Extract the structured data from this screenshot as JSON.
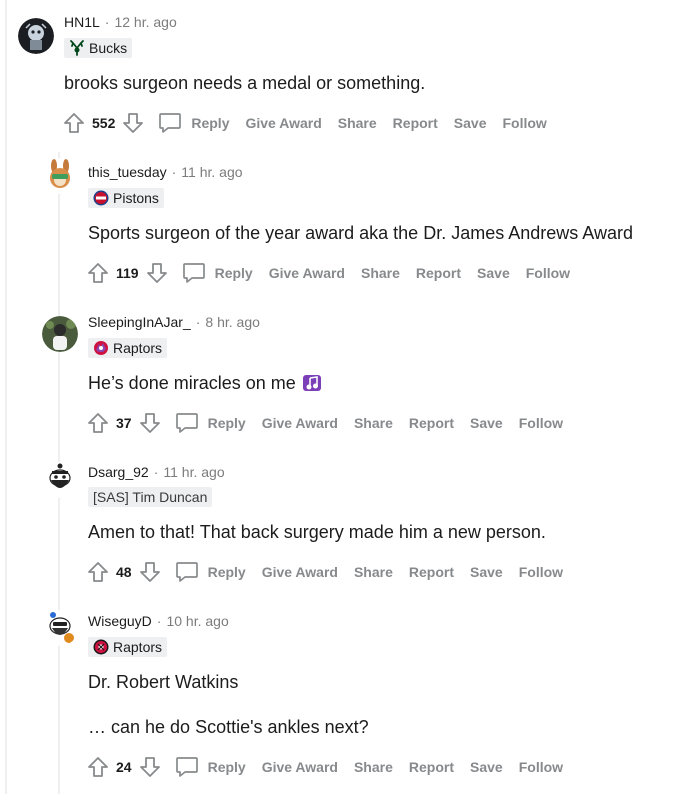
{
  "comments": [
    {
      "username": "HN1L",
      "time": "12 hr. ago",
      "flair": "Bucks",
      "body": [
        "brooks surgeon needs a medal or something."
      ],
      "score": "552"
    },
    {
      "username": "this_tuesday",
      "time": "11 hr. ago",
      "flair": "Pistons",
      "body": [
        "Sports surgeon of the year award aka the Dr. James Andrews Award"
      ],
      "score": "119"
    },
    {
      "username": "SleepingInAJar_",
      "time": "8 hr. ago",
      "flair": "Raptors",
      "body": [
        "He’s done miracles on me"
      ],
      "score": "37"
    },
    {
      "username": "Dsarg_92",
      "time": "11 hr. ago",
      "flair": "[SAS] Tim Duncan",
      "body": [
        "Amen to that! That back surgery made him a new person."
      ],
      "score": "48"
    },
    {
      "username": "WiseguyD",
      "time": "10 hr. ago",
      "flair": "Raptors",
      "body": [
        "Dr. Robert Watkins",
        "… can he do Scottie's ankles next?"
      ],
      "score": "24"
    }
  ],
  "actions": {
    "reply": "Reply",
    "give_award": "Give Award",
    "share": "Share",
    "report": "Report",
    "save": "Save",
    "follow": "Follow"
  },
  "separator": "·",
  "icons": {
    "upvote": "upvote-arrow-icon",
    "downvote": "downvote-arrow-icon",
    "reply": "speech-bubble-icon",
    "bucks_flair": "deer-antlers-icon",
    "pistons_flair": "pistons-logo-icon",
    "raptors_flair": "raptors-logo-icon",
    "emoji": "music-note-emoji-icon"
  },
  "colors": {
    "action_gray": "#878a8c",
    "meta_gray": "#7c7c7c",
    "flair_bg": "#edeff1",
    "bucks_green": "#00471b",
    "pistons_red": "#c8102e",
    "raptors_red": "#ce1141",
    "emoji_purple": "#7b3fb8"
  }
}
